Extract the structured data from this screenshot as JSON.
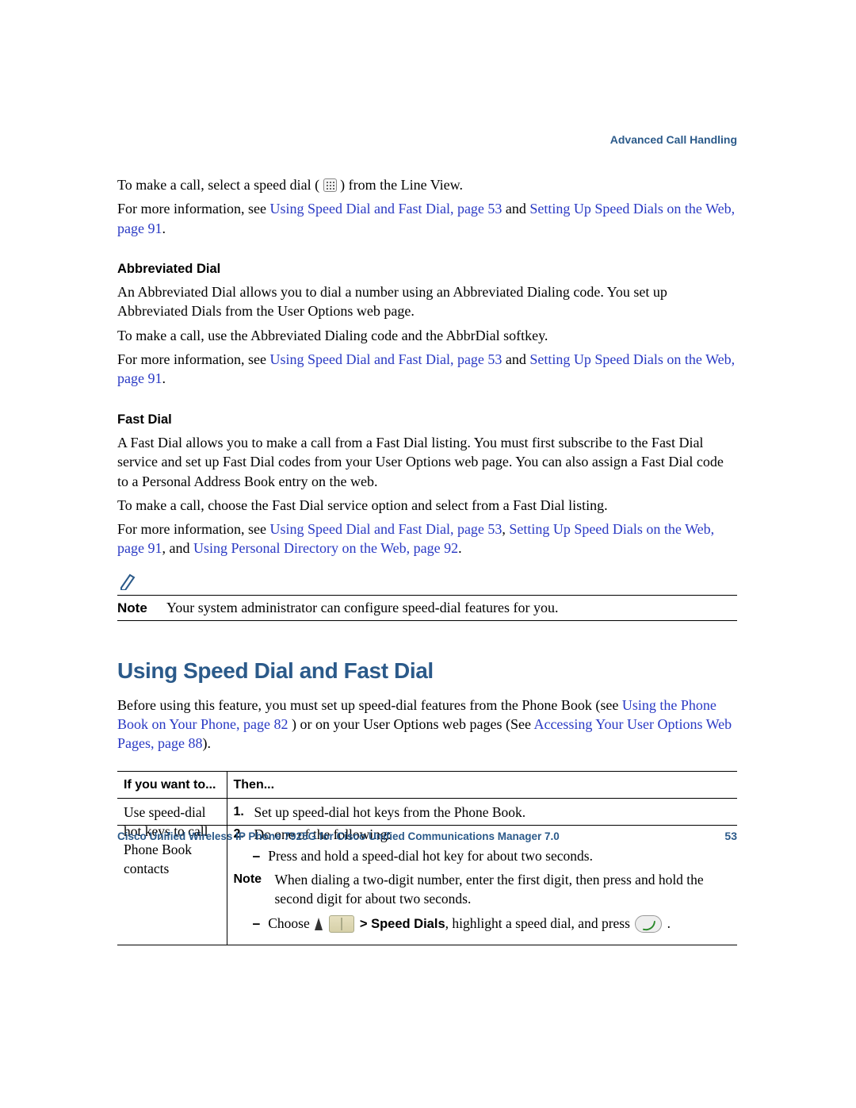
{
  "header": {
    "section_title": "Advanced Call Handling"
  },
  "intro": {
    "p1_a": "To make a call, select a speed dial ( ",
    "p1_b": " ) from the Line View.",
    "p2_a": "For more information, see ",
    "link1": "Using Speed Dial and Fast Dial, page 53",
    "p2_b": " and ",
    "link2": "Setting Up Speed Dials on the Web, page 91",
    "p2_c": "."
  },
  "abbrev": {
    "heading": "Abbreviated Dial",
    "p1": "An Abbreviated Dial allows you to dial a number using an Abbreviated Dialing code. You set up Abbreviated Dials from the User Options web page.",
    "p2": "To make a call, use the Abbreviated Dialing code and the AbbrDial softkey.",
    "p3_a": "For more information, see ",
    "link1": "Using Speed Dial and Fast Dial, page 53",
    "p3_b": " and ",
    "link2": "Setting Up Speed Dials on the Web, page 91",
    "p3_c": "."
  },
  "fast": {
    "heading": "Fast Dial",
    "p1": "A Fast Dial allows you to make a call from a Fast Dial listing. You must first subscribe to the Fast Dial service and set up Fast Dial codes from your User Options web page. You can also assign a Fast Dial code to a Personal Address Book entry on the web.",
    "p2": "To make a call, choose the Fast Dial service option and select from a Fast Dial listing.",
    "p3_a": "For more information, see ",
    "link1": "Using Speed Dial and Fast Dial, page 53",
    "p3_b": ", ",
    "link2": "Setting Up Speed Dials on the Web, page 91",
    "p3_c": ", and ",
    "link3": "Using Personal Directory on the Web, page 92",
    "p3_d": "."
  },
  "note1": {
    "label": "Note",
    "text": "Your system administrator can configure speed-dial features for you."
  },
  "main": {
    "heading": "Using Speed Dial and Fast Dial",
    "intro_a": "Before using this feature, you must set up speed-dial features from the Phone Book (see ",
    "link1": "Using the Phone Book on Your Phone, page 82",
    "intro_b": ") or on your User Options web pages (See ",
    "link2": "Accessing Your User Options Web Pages, page 88",
    "intro_c": ")."
  },
  "table": {
    "col1": "If you want to...",
    "col2": "Then...",
    "row1_left": "Use speed-dial hot keys to call Phone Book contacts",
    "r1_num1": "1.",
    "r1_step1": "Set up speed-dial hot keys from the Phone Book.",
    "r1_num2": "2.",
    "r1_step2": "Do one of the following:",
    "r1_dash1": "Press and hold a speed-dial hot key for about two seconds.",
    "inner_note_label": "Note",
    "inner_note_text": "When dialing a two-digit number, enter the first digit, then press and hold the second digit for about two seconds.",
    "r1_dash2_a": "Choose ",
    "r1_dash2_b": "  > Speed Dials",
    "r1_dash2_c": ", highlight a speed dial, and press ",
    "r1_dash2_d": " ."
  },
  "footer": {
    "title": "Cisco Unified Wireless IP Phone 7925G for Cisco Unified Communications Manager 7.0",
    "page": "53"
  }
}
